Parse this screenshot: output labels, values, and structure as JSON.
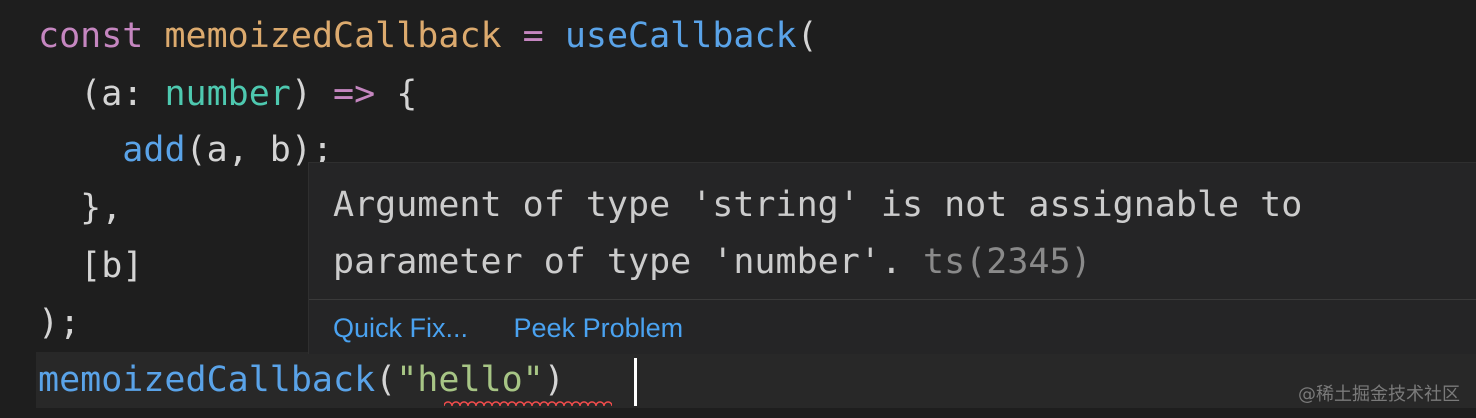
{
  "code": {
    "line1": {
      "kw": "const",
      "var": "memoizedCallback",
      "op": "=",
      "fn": "useCallback",
      "paren": "("
    },
    "line2": {
      "open": "(a: ",
      "type": "number",
      "close": ") ",
      "arrow": "=>",
      "brace": " {"
    },
    "line3": {
      "fn": "add",
      "args": "(a, b);"
    },
    "line4": {
      "text": "},"
    },
    "line5": {
      "text": "[b]"
    },
    "line6": {
      "text": ");"
    },
    "line7": {
      "fn": "memoizedCallback",
      "open": "(",
      "str": "\"hello\"",
      "close": ")"
    }
  },
  "hover": {
    "message_line1": "Argument of type 'string' is not assignable to",
    "message_line2": "parameter of type 'number'.",
    "code": "ts(2345)",
    "quick_fix": "Quick Fix...",
    "peek_problem": "Peek Problem"
  },
  "watermark": "@稀土掘金技术社区",
  "colors": {
    "background": "#1e1e1e",
    "keyword": "#c586c0",
    "variable": "#dcaa6e",
    "function": "#5aa3e8",
    "type": "#4ec9b0",
    "string": "#a7c585",
    "error": "#f14c4c",
    "link": "#4aa2f0"
  }
}
